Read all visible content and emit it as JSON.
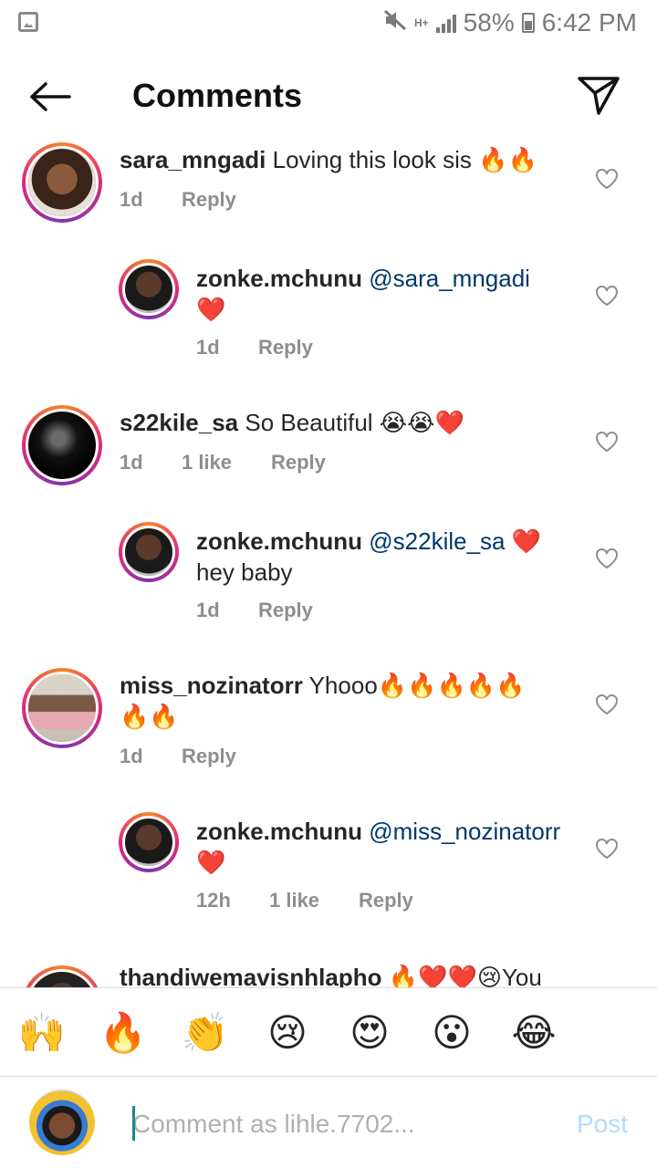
{
  "status_bar": {
    "battery": "58%",
    "time": "6:42 PM",
    "network": "H+",
    "icons": [
      "gallery-icon",
      "mute-icon",
      "signal-icon",
      "battery-icon"
    ]
  },
  "header": {
    "title": "Comments",
    "icons": [
      "back-arrow-icon",
      "send-icon"
    ]
  },
  "comments": [
    {
      "username": "sara_mngadi",
      "mention": "",
      "text": "Loving this look sis 🔥🔥",
      "time": "1d",
      "likes": "",
      "reply_label": "Reply",
      "is_reply": false
    },
    {
      "username": "zonke.mchunu",
      "mention": "@sara_mngadi",
      "text": "❤️",
      "time": "1d",
      "likes": "",
      "reply_label": "Reply",
      "is_reply": true
    },
    {
      "username": "s22kile_sa",
      "mention": "",
      "text": "So Beautiful 😭😭❤️",
      "time": "1d",
      "likes": "1 like",
      "reply_label": "Reply",
      "is_reply": false
    },
    {
      "username": "zonke.mchunu",
      "mention": "@s22kile_sa",
      "text": "❤️hey baby",
      "time": "1d",
      "likes": "",
      "reply_label": "Reply",
      "is_reply": true
    },
    {
      "username": "miss_nozinatorr",
      "mention": "",
      "text": "Yhooo🔥🔥🔥🔥🔥🔥🔥",
      "time": "1d",
      "likes": "",
      "reply_label": "Reply",
      "is_reply": false
    },
    {
      "username": "zonke.mchunu",
      "mention": "@miss_nozinatorr",
      "text": "❤️",
      "time": "12h",
      "likes": "1 like",
      "reply_label": "Reply",
      "is_reply": true
    },
    {
      "username": "thandiwemavisnhlapho",
      "mention": "",
      "text": "🔥❤️❤️😢You",
      "time": "",
      "likes": "",
      "reply_label": "",
      "is_reply": false
    }
  ],
  "emoji_bar": [
    "🙌",
    "🔥",
    "👏",
    "😢",
    "😍",
    "😮",
    "😂"
  ],
  "composer": {
    "placeholder": "Comment as lihle.7702...",
    "post_label": "Post"
  },
  "colors": {
    "mention": "#00376b",
    "meta_gray": "#8e8e8e",
    "post_disabled": "#b3dbff",
    "story_ring": [
      "#f58529",
      "#dd2a7b",
      "#8134af"
    ]
  }
}
